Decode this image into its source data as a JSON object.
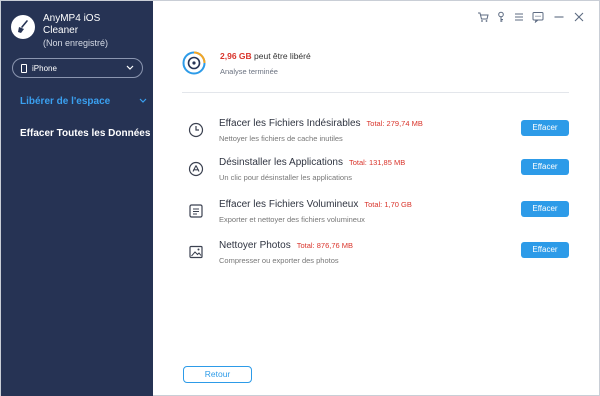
{
  "app": {
    "name": "AnyMP4 iOS",
    "name_line2": "Cleaner",
    "registration": "(Non enregistré)"
  },
  "device": {
    "selected": "iPhone"
  },
  "sidebar": {
    "items": [
      {
        "label": "Libérer de l'espace",
        "active": true
      },
      {
        "label": "Effacer Toutes les Données",
        "active": false
      }
    ]
  },
  "titlebar": {
    "icons": [
      "cart-icon",
      "key-icon",
      "menu-icon",
      "chat-icon",
      "minimize-icon",
      "close-icon"
    ]
  },
  "summary": {
    "amount": "2,96 GB",
    "amount_suffix": " peut être libéré",
    "status": "Analyse terminée"
  },
  "rows": [
    {
      "title": "Effacer les Fichiers Indésirables",
      "total": "Total: 279,74 MB",
      "desc": "Nettoyer les fichiers de cache inutiles",
      "button": "Effacer",
      "icon": "clock-icon"
    },
    {
      "title": "Désinstaller les Applications",
      "total": "Total: 131,85 MB",
      "desc": "Un clic pour désinstaller les applications",
      "button": "Effacer",
      "icon": "app-store-icon"
    },
    {
      "title": "Effacer les Fichiers Volumineux",
      "total": "Total: 1,70 GB",
      "desc": "Exporter et nettoyer des fichiers volumineux",
      "button": "Effacer",
      "icon": "document-icon"
    },
    {
      "title": "Nettoyer Photos",
      "total": "Total: 876,76 MB",
      "desc": "Compresser ou exporter des photos",
      "button": "Effacer",
      "icon": "photo-icon"
    }
  ],
  "footer": {
    "back_label": "Retour"
  },
  "colors": {
    "sidebar": "#263354",
    "accent": "#2d9be8",
    "highlight": "#d9342b"
  }
}
